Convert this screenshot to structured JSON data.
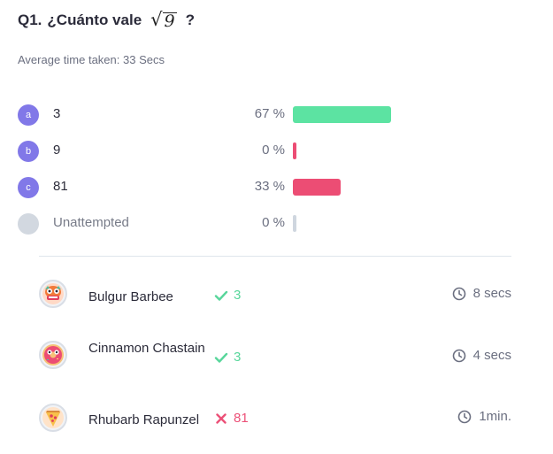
{
  "question": {
    "prefix": "Q1.",
    "text": "¿Cuánto vale",
    "radical": "9",
    "question_mark": "?"
  },
  "average_time": "Average time taken: 33 Secs",
  "options": [
    {
      "badge": "a",
      "label": "3",
      "percent_text": "67 %",
      "percent": 67,
      "color": "#5ce3a2"
    },
    {
      "badge": "b",
      "label": "9",
      "percent_text": "0 %",
      "percent": 0,
      "color": "#ec4d74"
    },
    {
      "badge": "c",
      "label": "81",
      "percent_text": "33 %",
      "percent": 33,
      "color": "#ec4d74"
    },
    {
      "badge": "",
      "label": "Unattempted",
      "percent_text": "0 %",
      "percent": 0,
      "color": "#cfd6df"
    }
  ],
  "responses": [
    {
      "name": "Bulgur Barbee",
      "answer": "3",
      "correct": true,
      "time": "8 secs",
      "avatar": "monster-avatar-icon"
    },
    {
      "name": "Cinnamon Chastain",
      "answer": "3",
      "correct": true,
      "time": "4 secs",
      "avatar": "donut-avatar-icon"
    },
    {
      "name": "Rhubarb Rapunzel",
      "answer": "81",
      "correct": false,
      "time": "1min.",
      "avatar": "pizza-avatar-icon"
    }
  ],
  "colors": {
    "badge": "#8178e8",
    "correct": "#58d69b",
    "wrong": "#ec5178"
  }
}
